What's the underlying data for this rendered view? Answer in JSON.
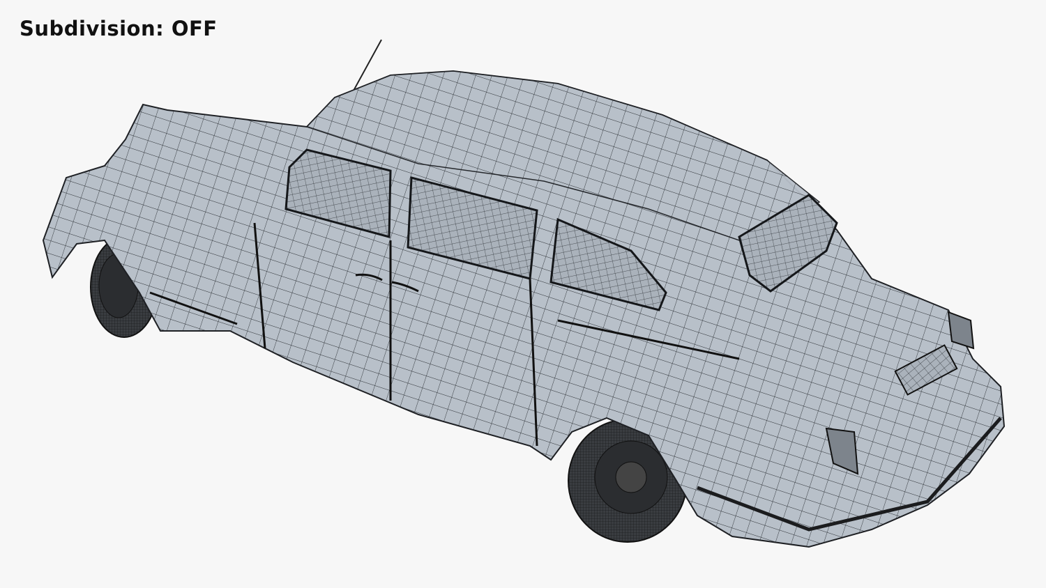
{
  "overlay": {
    "label": "Subdivision:",
    "state": "OFF"
  },
  "colors": {
    "background": "#f7f7f7",
    "body": "#b8c0c9",
    "wire": "#2a2e33",
    "glass": "#8c939b",
    "tire": "#2b2d30"
  }
}
